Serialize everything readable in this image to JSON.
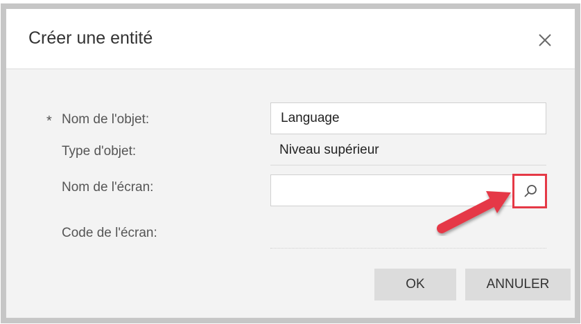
{
  "dialog": {
    "title": "Créer une entité",
    "close_icon": "close-icon"
  },
  "form": {
    "required_marker": "*",
    "object_name": {
      "label": "Nom de l'objet:",
      "value": "Language",
      "required": true
    },
    "object_type": {
      "label": "Type d'objet:",
      "value": "Niveau supérieur"
    },
    "screen_name": {
      "label": "Nom de l'écran:",
      "value": "",
      "lookup_icon": "search-icon"
    },
    "screen_code": {
      "label": "Code de l'écran:",
      "value": ""
    }
  },
  "buttons": {
    "ok_label": "OK",
    "cancel_label": "ANNULER"
  },
  "annotation": {
    "highlight_color": "#e53946",
    "arrow_color": "#e53946"
  }
}
